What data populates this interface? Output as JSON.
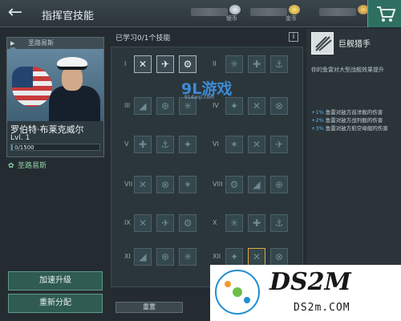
{
  "header": {
    "back_glyph": "←",
    "title": "指挥官技能",
    "currencies": [
      {
        "label": "银币",
        "icon": "silver-coin-icon"
      },
      {
        "label": "金币",
        "icon": "gold-coin-icon"
      },
      {
        "label": "",
        "icon": "gold-coin-icon"
      }
    ],
    "cart_icon": "shopping-cart-icon"
  },
  "commander": {
    "ship_tag": "圣路易斯",
    "name": "罗伯特·布莱克威尔",
    "level": "Lvl. 1",
    "xp_text": "0/1500",
    "xp_progress": 0.02,
    "ship_name": "圣路易斯"
  },
  "left_buttons": {
    "speed_up": "加速升级",
    "reassign": "重新分配"
  },
  "skills": {
    "learned_label": "已学习0/1个技能",
    "info_label": "i",
    "rows": [
      "I",
      "II",
      "III",
      "IV",
      "V",
      "VI",
      "VII",
      "VIII",
      "IX",
      "X",
      "XI",
      "XII"
    ],
    "reset_label": "重置"
  },
  "detail": {
    "title": "巨舰猎手",
    "description": "你的鱼雷对大型战舰效果提升",
    "bonuses": [
      {
        "pct": "+1%",
        "text": "鱼雷对敌方巡洋舰的伤害"
      },
      {
        "pct": "+2%",
        "text": "鱼雷对敌方战列舰的伤害"
      },
      {
        "pct": "+3%",
        "text": "鱼雷对敌方航空母舰的伤害"
      }
    ]
  },
  "watermarks": {
    "site_big": "9L游戏",
    "site_small": "91danji.com",
    "ds2m": "DS2M",
    "ds2m_url": "DS2m.COM"
  },
  "colors": {
    "accent": "#2f6f61",
    "learned_border": "#a9b6ba",
    "selected_border": "#e3a83a",
    "bonus_pct": "#5fb7e8"
  }
}
